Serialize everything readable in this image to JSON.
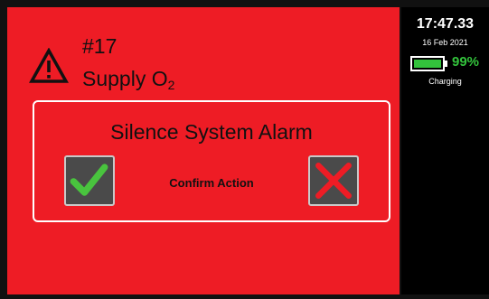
{
  "alarm": {
    "number": "#17",
    "name_prefix": "Supply O",
    "name_subscript": "2",
    "background_color": "#ee1c25"
  },
  "dialog": {
    "title": "Silence System Alarm",
    "confirm_text": "Confirm Action",
    "confirm_icon": "checkmark-icon",
    "cancel_icon": "x-icon"
  },
  "status": {
    "time": "17:47.33",
    "date": "16 Feb 2021",
    "battery_percent_label": "99%",
    "battery_level": 0.99,
    "charging_label": "Charging",
    "battery_color": "#33c23c"
  }
}
